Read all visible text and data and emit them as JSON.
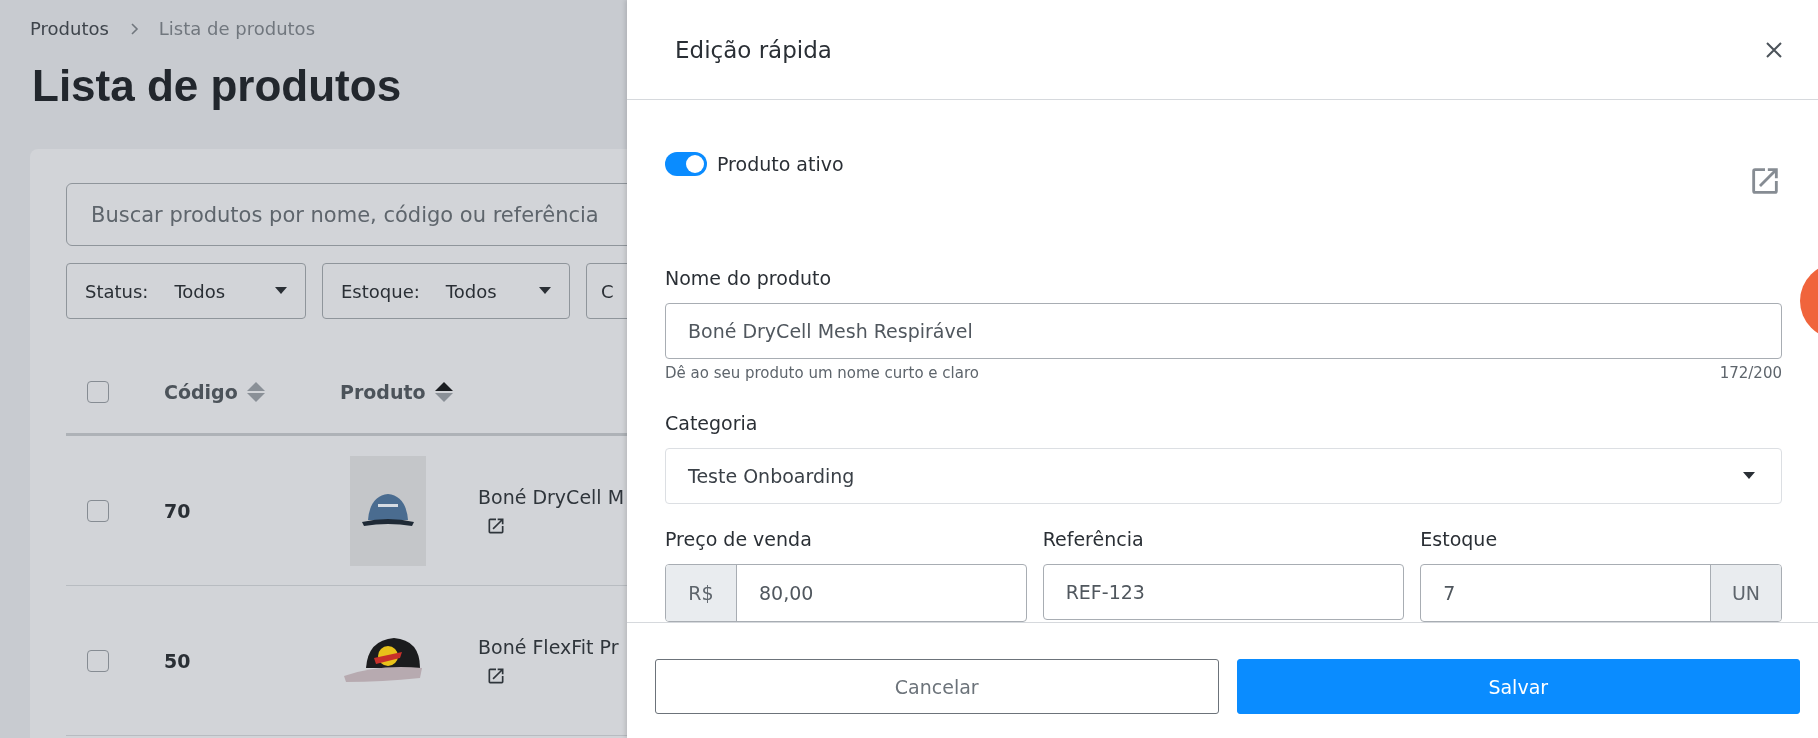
{
  "breadcrumb": [
    {
      "label": "Produtos"
    },
    {
      "label": "Lista de produtos"
    }
  ],
  "page_title": "Lista de produtos",
  "search": {
    "placeholder": "Buscar produtos por nome, código ou referência"
  },
  "filters": [
    {
      "label": "Status:",
      "value": "Todos"
    },
    {
      "label": "Estoque:",
      "value": "Todos"
    },
    {
      "label": "C"
    }
  ],
  "table": {
    "header_checked": false,
    "columns": [
      {
        "label": "Código",
        "sorted": false
      },
      {
        "label": "Produto",
        "sorted": true
      }
    ],
    "rows": [
      {
        "checked": false,
        "code": "70",
        "name": "Boné DryCell M"
      },
      {
        "checked": false,
        "code": "50",
        "name": "Boné FlexFit Pr"
      }
    ]
  },
  "drawer": {
    "title": "Edição rápida",
    "active_toggle": {
      "label": "Produto ativo",
      "on": true
    },
    "name_field": {
      "label": "Nome do produto",
      "value": "Boné DryCell Mesh Respirável",
      "hint": "Dê ao seu produto um nome curto e claro",
      "counter": "172/200"
    },
    "category": {
      "label": "Categoria",
      "value": "Teste Onboarding"
    },
    "price": {
      "label": "Preço de venda",
      "prefix": "R$",
      "value": "80,00"
    },
    "reference": {
      "label": "Referência",
      "value": "REF-123"
    },
    "stock": {
      "label": "Estoque",
      "value": "7",
      "suffix": "UN"
    },
    "buttons": [
      {
        "label": "Cancelar",
        "kind": "secondary"
      },
      {
        "label": "Salvar",
        "kind": "primary"
      }
    ]
  }
}
